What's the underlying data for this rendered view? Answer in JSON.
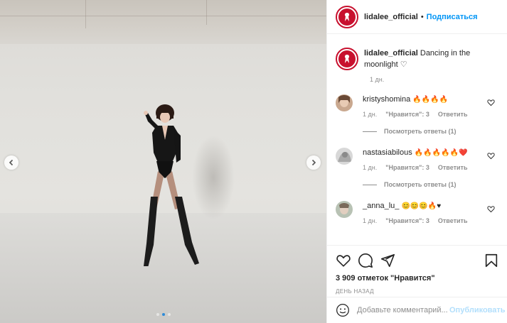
{
  "post": {
    "username": "lidalee_official",
    "follow_label": "Подписаться",
    "separator": "•",
    "caption_text": "Dancing in the moonlight ♡",
    "caption_time": "1 дн."
  },
  "comments": [
    {
      "username": "kristyshomina",
      "text": "🔥🔥🔥🔥",
      "time": "1 дн.",
      "likes": "\"Нравится\": 3",
      "reply": "Ответить",
      "view_replies": "Посмотреть ответы (1)"
    },
    {
      "username": "nastasiabilous",
      "text": "🔥🔥🔥🔥🔥❤️",
      "time": "1 дн.",
      "likes": "\"Нравится\": 3",
      "reply": "Ответить",
      "view_replies": "Посмотреть ответы (1)"
    },
    {
      "username": "_anna_lu_",
      "text": "😊😊😊🔥♥",
      "time": "1 дн.",
      "likes": "\"Нравится\": 3",
      "reply": "Ответить"
    }
  ],
  "actions": {
    "likes_text": "3 909 отметок \"Нравится\"",
    "posted_ago": "ДЕНЬ НАЗАД"
  },
  "add_comment": {
    "placeholder": "Добавьте комментарий...",
    "publish_label": "Опубликовать"
  },
  "carousel": {
    "current_index": 2,
    "total": 3
  },
  "colors": {
    "accent": "#0095f6",
    "avatar_ring": "#c8102e",
    "carousel_active": "#2e8bd8"
  }
}
